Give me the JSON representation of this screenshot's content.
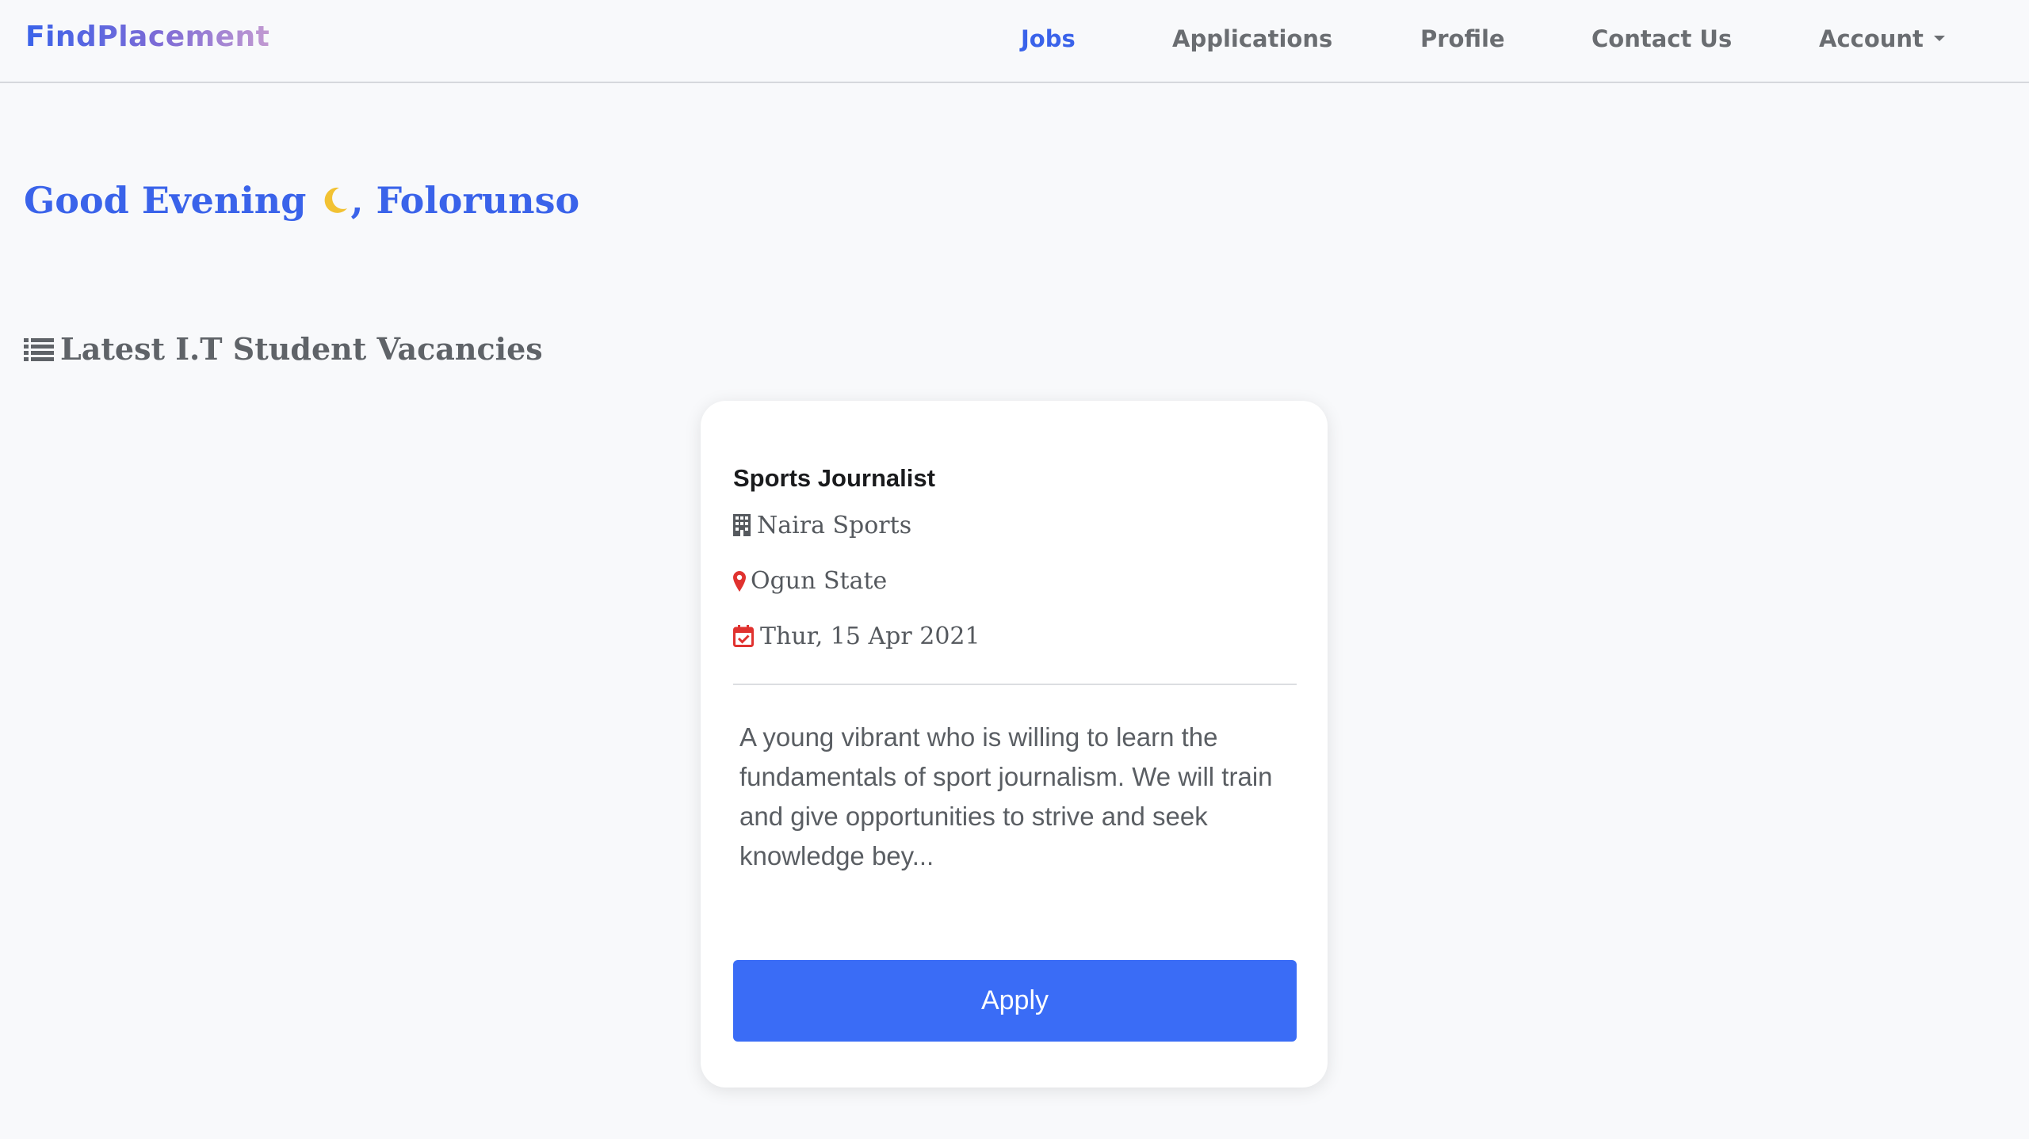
{
  "navbar": {
    "brand": "FindPlacement",
    "items": [
      {
        "label": "Jobs",
        "active": true
      },
      {
        "label": "Applications",
        "active": false
      },
      {
        "label": "Profile",
        "active": false
      },
      {
        "label": "Contact Us",
        "active": false
      },
      {
        "label": "Account",
        "active": false,
        "dropdown": true
      }
    ]
  },
  "greeting": {
    "prefix": "Good Evening",
    "icon": "moon-icon",
    "name": ", Folorunso"
  },
  "section": {
    "title": "Latest I.T Student Vacancies",
    "icon": "list-icon"
  },
  "job": {
    "title": "Sports Journalist",
    "company": "Naira Sports",
    "company_icon": "building-icon",
    "location": "Ogun State",
    "location_icon": "map-marker-icon",
    "date": "Thur, 15 Apr 2021",
    "date_icon": "calendar-check-icon",
    "description": "A young vibrant who is willing to learn the fundamentals of sport journalism. We will train and give opportunities to strive and seek knowledge bey...",
    "apply_label": "Apply"
  },
  "colors": {
    "accent": "#3a63ea",
    "button": "#3a6cf6",
    "icon_red": "#e0322f",
    "text_muted": "#6a6d71"
  }
}
